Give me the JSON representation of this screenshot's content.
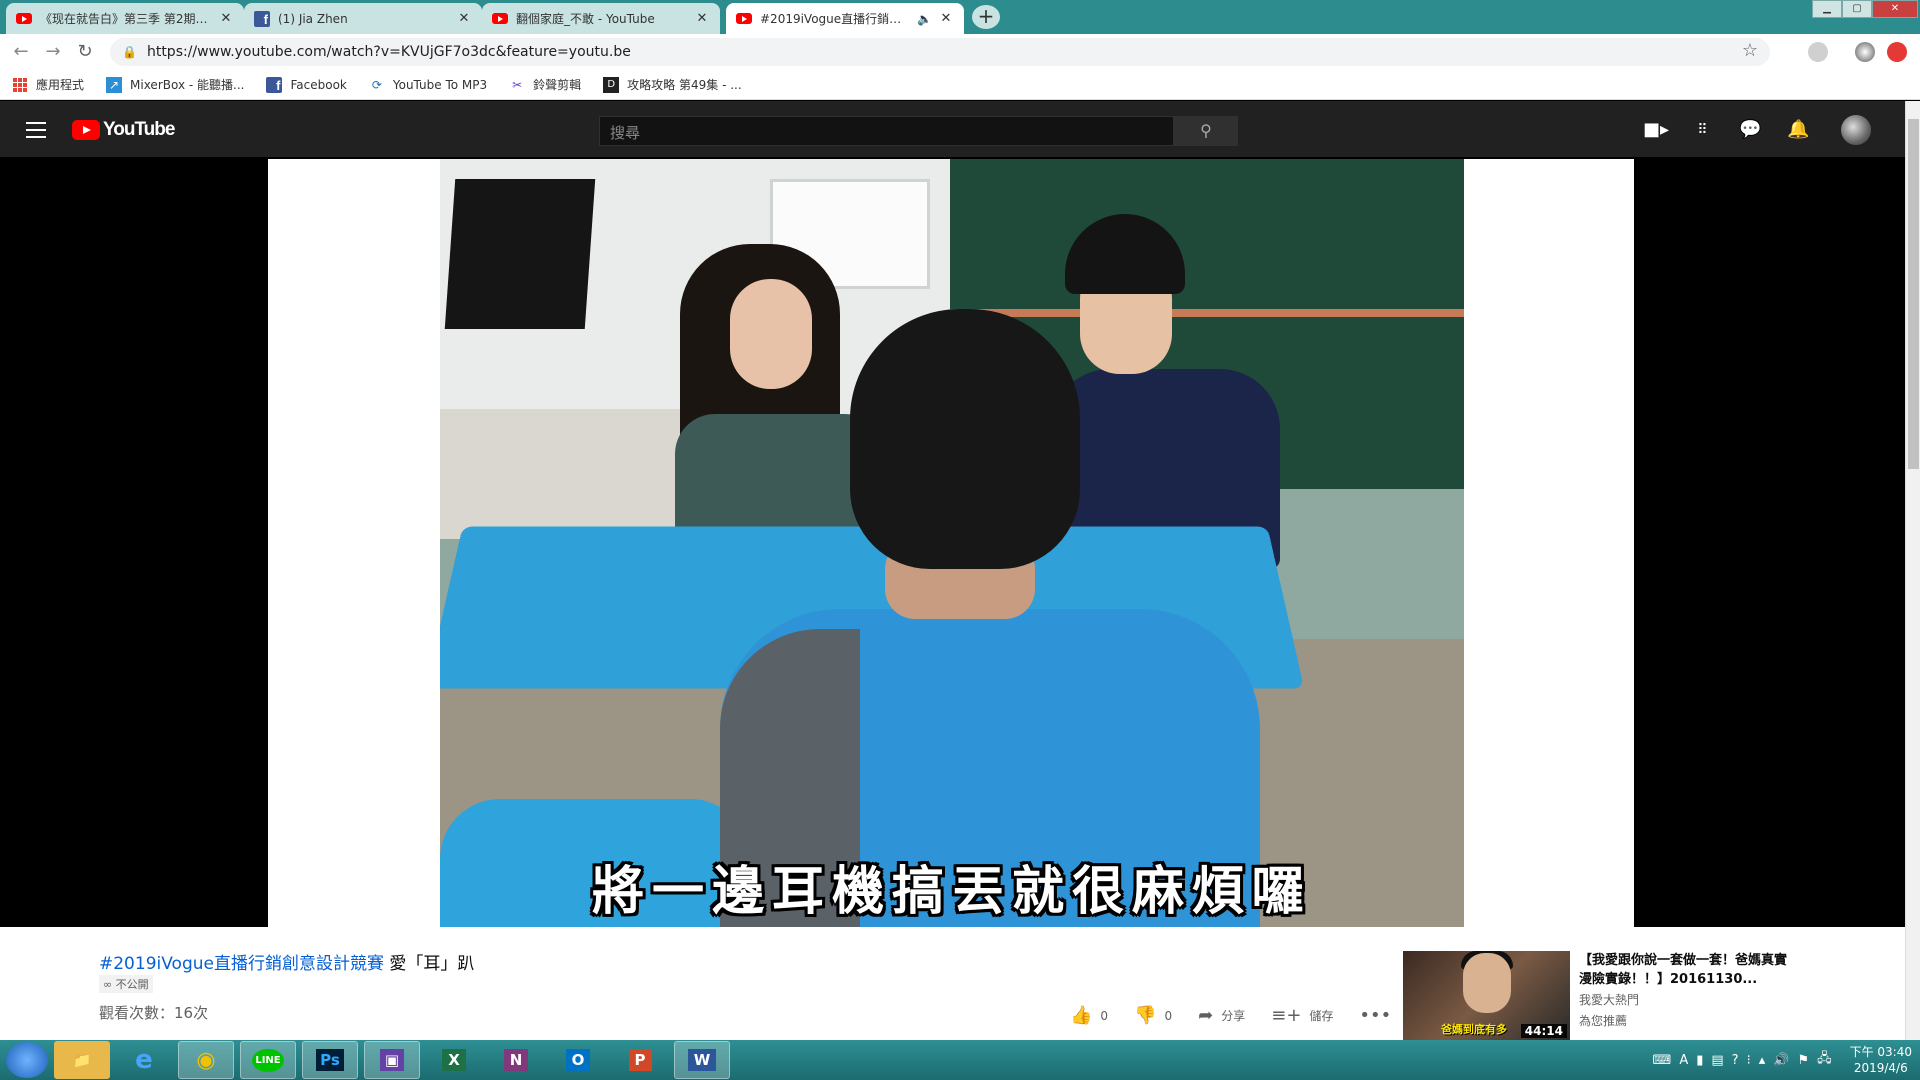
{
  "browser": {
    "tabs": [
      {
        "title": "《现在就告白》第三季 第2期：...",
        "icon": "youtube-icon",
        "active": false
      },
      {
        "title": "(1) Jia Zhen",
        "icon": "facebook-icon",
        "active": false
      },
      {
        "title": "翻個家庭_不敢 - YouTube",
        "icon": "youtube-icon",
        "active": false
      },
      {
        "title": "#2019iVogue直播行銷創意",
        "icon": "youtube-icon",
        "active": true
      }
    ],
    "tab_close": "✕",
    "new_tab": "+",
    "url": "https://www.youtube.com/watch?v=KVUjGF7o3dc&feature=youtu.be"
  },
  "bookmarks": [
    {
      "label": "應用程式",
      "icon": "apps-grid-icon"
    },
    {
      "label": "MixerBox - 能聽播...",
      "icon": "mixerbox-icon"
    },
    {
      "label": "Facebook",
      "icon": "facebook-icon"
    },
    {
      "label": "YouTube To MP3",
      "icon": "convert-icon"
    },
    {
      "label": "鈴聲剪輯",
      "icon": "scissors-icon"
    },
    {
      "label": "攻略攻略 第49集 - ...",
      "icon": "dark-square-icon"
    }
  ],
  "youtube": {
    "logo": "YouTube",
    "search_placeholder": "搜尋"
  },
  "video": {
    "caption": "將一邊耳機搞丟就很麻煩囉",
    "title_tag": "#2019iVogue直播行銷創意設計競賽",
    "title_rest": " 愛「耳」趴",
    "privacy": "∞ 不公開",
    "views": "觀看次數：16次",
    "likes": "0",
    "dislikes": "0",
    "share_label": "分享",
    "save_label": "儲存"
  },
  "recommendation": {
    "title": "【我愛跟你說一套做一套！爸媽真實漫險實錄！！】20161130...",
    "channel": "我愛大熱門",
    "reason": "為您推薦",
    "duration": "44:14",
    "overlay_text": "爸媽到底有多"
  },
  "taskbar": {
    "apps": [
      {
        "name": "file-explorer",
        "label": "📁"
      },
      {
        "name": "internet-explorer",
        "label": "e"
      },
      {
        "name": "chrome",
        "label": "◉"
      },
      {
        "name": "line",
        "label": "LINE"
      },
      {
        "name": "photoshop",
        "label": "Ps"
      },
      {
        "name": "twitch",
        "label": "▣"
      },
      {
        "name": "excel",
        "label": "X"
      },
      {
        "name": "onenote",
        "label": "N"
      },
      {
        "name": "outlook",
        "label": "O"
      },
      {
        "name": "powerpoint",
        "label": "P"
      },
      {
        "name": "word",
        "label": "W"
      }
    ],
    "time": "下午 03:40",
    "date": "2019/4/6"
  },
  "colors": {
    "tab_strip": "#2c8c8e",
    "youtube_red": "#ff0000",
    "masthead": "#212121",
    "link_blue": "#065fd4"
  }
}
